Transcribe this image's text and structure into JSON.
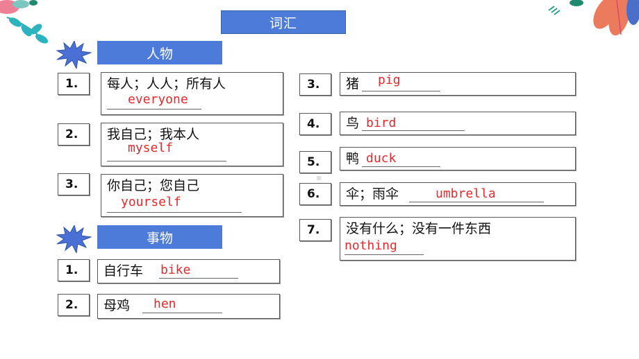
{
  "title": "词汇",
  "colors": {
    "accent": "#4d7bd9",
    "answer": "#e8282a"
  },
  "sections": [
    {
      "label": "人物",
      "icon": "star-burst-icon",
      "items": [
        {
          "number": "1.",
          "chinese": "每人；人人；所有人",
          "answer": "everyone"
        },
        {
          "number": "2.",
          "chinese": "我自己；我本人",
          "answer": "myself"
        },
        {
          "number": "3.",
          "chinese": "你自己；您自己",
          "answer": "yourself"
        }
      ]
    },
    {
      "label": "事物",
      "icon": "star-burst-icon",
      "items": [
        {
          "number": "1.",
          "chinese": "自行车",
          "answer": "bike"
        },
        {
          "number": "2.",
          "chinese": "母鸡",
          "answer": "hen"
        },
        {
          "number": "3.",
          "chinese": "猪",
          "answer": "pig"
        },
        {
          "number": "4.",
          "chinese": "鸟",
          "answer": "bird"
        },
        {
          "number": "5.",
          "chinese": "鸭",
          "answer": "duck"
        },
        {
          "number": "6.",
          "chinese": "伞；雨伞",
          "answer": "umbrella"
        },
        {
          "number": "7.",
          "chinese": "没有什么；没有一件东西",
          "answer": "nothing"
        }
      ]
    }
  ]
}
